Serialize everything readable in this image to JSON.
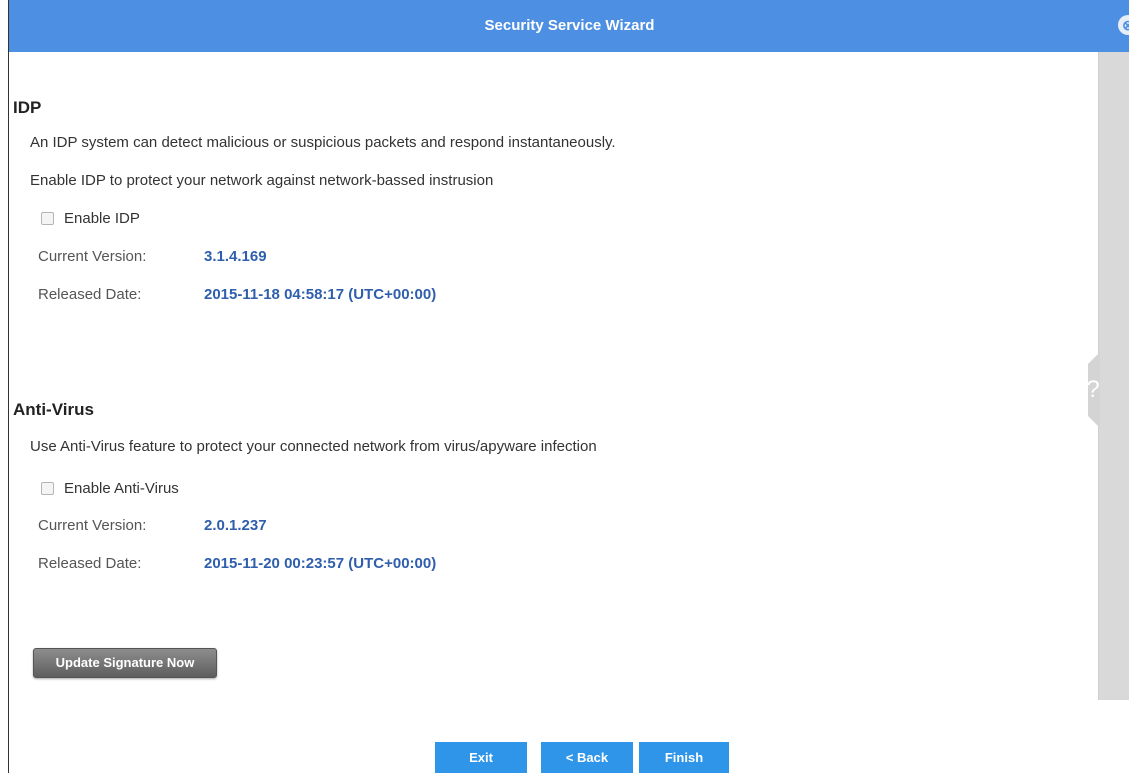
{
  "window": {
    "title": "Security Service Wizard",
    "close_glyph": "⊗"
  },
  "idp": {
    "heading": "IDP",
    "description1": "An IDP system can detect malicious or suspicious packets and respond instantaneously.",
    "description2": "Enable IDP to protect your network against network-bassed instrusion",
    "enable_label": "Enable IDP",
    "enable_checked": false,
    "current_version_label": "Current Version:",
    "current_version": "3.1.4.169",
    "released_date_label": "Released Date:",
    "released_date": "2015-11-18 04:58:17 (UTC+00:00)"
  },
  "antivirus": {
    "heading": "Anti-Virus",
    "description": "Use Anti-Virus feature to protect your connected network from virus/apyware infection",
    "enable_label": "Enable Anti-Virus",
    "enable_checked": false,
    "current_version_label": "Current Version:",
    "current_version": "2.0.1.237",
    "released_date_label": "Released Date:",
    "released_date": "2015-11-20 00:23:57 (UTC+00:00)"
  },
  "buttons": {
    "update_signature": "Update Signature Now",
    "exit": "Exit",
    "back": "< Back",
    "finish": "Finish"
  },
  "help": {
    "glyph": "?"
  },
  "colors": {
    "titlebar": "#4d8fe3",
    "value_text": "#2f5eac",
    "primary_button": "#2f95e9",
    "update_button": "#6f6f6f"
  }
}
